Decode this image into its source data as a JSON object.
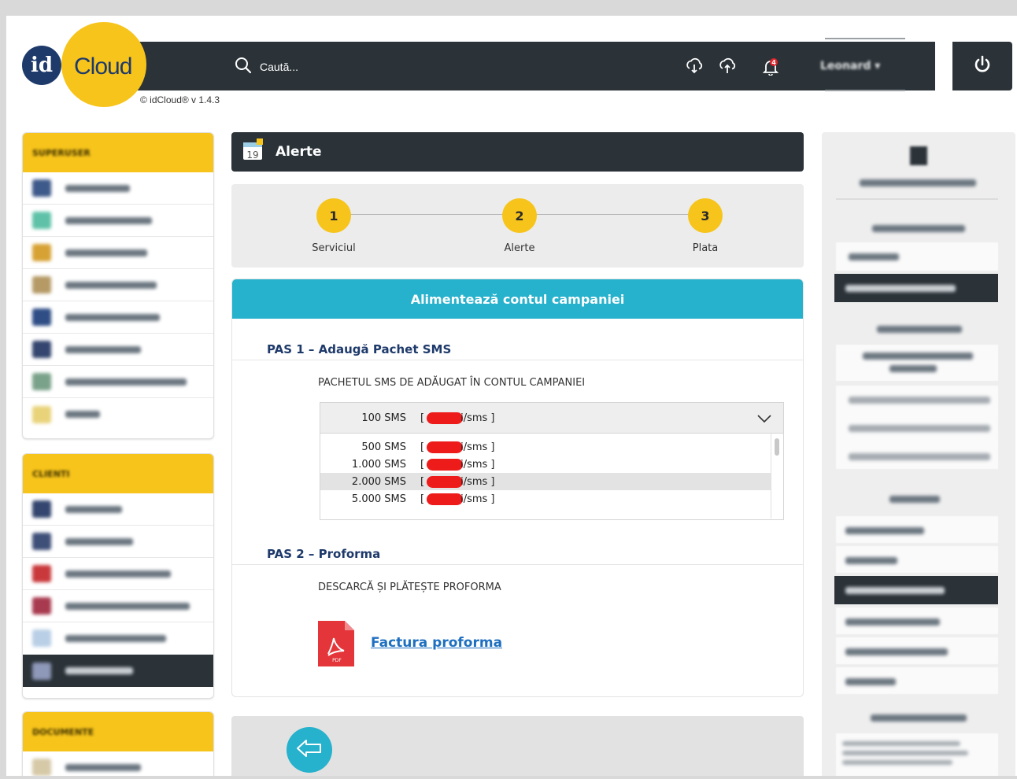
{
  "app": {
    "logo_id": "id",
    "logo_name": "Cloud",
    "version": "© idCloud® v 1.4.3"
  },
  "header": {
    "search_placeholder": "Caută...",
    "notification_count": "4",
    "user_label": "Leonard ▾",
    "icons": [
      "search-icon",
      "cloud-download-icon",
      "cloud-upload-icon",
      "bell-icon",
      "power-icon"
    ]
  },
  "colors": {
    "accent_yellow": "#f7c41b",
    "dark": "#2b3339",
    "teal": "#26b1cc",
    "link_blue": "#1e6fc0",
    "redaction": "#ee1b1b"
  },
  "sidebar": {
    "sections": [
      {
        "title": "SUPERUSER",
        "item_count": 8
      },
      {
        "title": "CLIENTI",
        "item_count": 6,
        "active_index": 5
      },
      {
        "title": "DOCUMENTE",
        "item_count": 1
      }
    ]
  },
  "page": {
    "title": "Alerte",
    "calendar_day": "19"
  },
  "wizard": {
    "steps": [
      {
        "num": "1",
        "label": "Serviciul"
      },
      {
        "num": "2",
        "label": "Alerte"
      },
      {
        "num": "3",
        "label": "Plata"
      }
    ]
  },
  "card": {
    "title": "Alimentează contul campaniei",
    "pas1": {
      "title": "PAS 1 – Adaugă Pachet SMS",
      "subtitle": "PACHETUL SMS DE ADĂUGAT ÎN CONTUL CAMPANIEI",
      "selected": {
        "qty": "100 SMS",
        "unit": "i/sms ]"
      },
      "options": [
        {
          "qty": "500 SMS",
          "unit": "i/sms ]"
        },
        {
          "qty": "1.000 SMS",
          "unit": "i/sms ]"
        },
        {
          "qty": "2.000 SMS",
          "unit": "i/sms ]"
        },
        {
          "qty": "5.000 SMS",
          "unit": "i/sms ]"
        }
      ],
      "highlighted_option_index": 2
    },
    "pas2": {
      "title": "PAS 2 – Proforma",
      "subtitle": "DESCARCĂ ȘI PLĂTEȘTE PROFORMA",
      "link": "Factura proforma",
      "pdf_badge": "PDF"
    }
  },
  "footer": {
    "back_icon": "arrow-left-icon"
  }
}
